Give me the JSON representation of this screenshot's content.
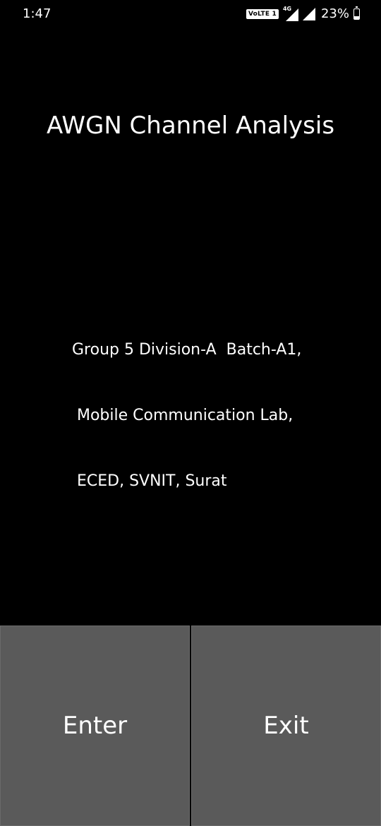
{
  "status_bar": {
    "time": "1:47",
    "volte_label": "VoLTE 1",
    "network_type": "4G",
    "battery_percent": "23%",
    "battery_level": 0.23
  },
  "app": {
    "title": "AWGN Channel Analysis",
    "credits": [
      "Group 5 Division-A  Batch-A1,",
      " Mobile Communication Lab,",
      " ECED, SVNIT, Surat"
    ]
  },
  "buttons": {
    "enter_label": "Enter",
    "exit_label": "Exit"
  },
  "colors": {
    "background": "#000000",
    "button": "#5a5a5a",
    "text": "#ffffff"
  }
}
